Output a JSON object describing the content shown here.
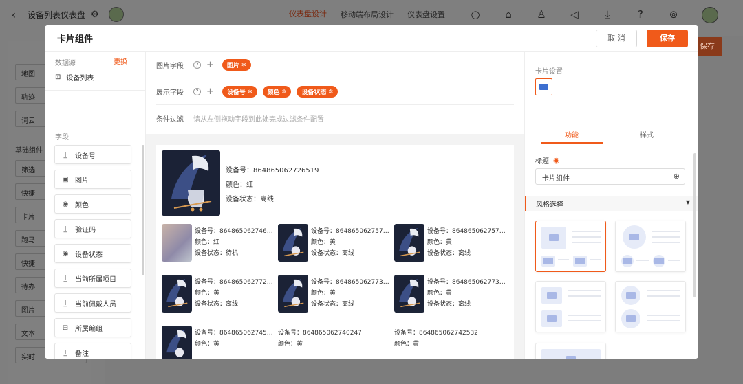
{
  "app": {
    "title": "设备列表仪表盘",
    "tabs": [
      {
        "label": "仪表盘设计",
        "active": true
      },
      {
        "label": "移动端布局设计",
        "active": false
      },
      {
        "label": "仪表盘设置",
        "active": false
      }
    ],
    "save_label": "保存",
    "sidebar_section": "基础组件",
    "sidebar_items": [
      "地图",
      "轨迹",
      "词云",
      "筛选",
      "快捷",
      "卡片",
      "跑马",
      "快捷",
      "待办",
      "图片",
      "文本",
      "实时"
    ]
  },
  "modal": {
    "title": "卡片组件",
    "cancel_label": "取 消",
    "save_label": "保存",
    "left": {
      "datasource_label": "数据源",
      "change_label": "更换",
      "datasource_name": "设备列表",
      "fields_label": "字段",
      "fields": [
        {
          "label": "设备号",
          "icon": "text-field-icon",
          "glyph": "I̲"
        },
        {
          "label": "图片",
          "icon": "image-field-icon",
          "glyph": "▣"
        },
        {
          "label": "颜色",
          "icon": "radio-field-icon",
          "glyph": "◉"
        },
        {
          "label": "验证码",
          "icon": "text-field-icon",
          "glyph": "I̲"
        },
        {
          "label": "设备状态",
          "icon": "radio-field-icon",
          "glyph": "◉"
        },
        {
          "label": "当前所属项目",
          "icon": "text-field-icon",
          "glyph": "I̲"
        },
        {
          "label": "当前佩戴人员",
          "icon": "text-field-icon",
          "glyph": "I̲"
        },
        {
          "label": "所属编组",
          "icon": "group-field-icon",
          "glyph": "⊟"
        },
        {
          "label": "备注",
          "icon": "text-field-icon",
          "glyph": "I̲"
        }
      ]
    },
    "center": {
      "image_field_label": "图片字段",
      "image_tags": [
        "图片"
      ],
      "display_field_label": "展示字段",
      "display_tags": [
        "设备号",
        "颜色",
        "设备状态"
      ],
      "filter_label": "条件过滤",
      "filter_hint": "请从左侧拖动字段到此处完成过滤条件配置",
      "featured": {
        "device_no": "设备号：864865062726519",
        "color": "颜色：红",
        "status": "设备状态：离线"
      },
      "cards": [
        {
          "device_no": "设备号：8648650627465...",
          "color": "颜色：红",
          "status": "设备状态：待机",
          "thumb": "photo"
        },
        {
          "device_no": "设备号：8648650627579...",
          "color": "颜色：黄",
          "status": "设备状态：离线",
          "thumb": "device"
        },
        {
          "device_no": "设备号：8648650627577...",
          "color": "颜色：黄",
          "status": "设备状态：离线",
          "thumb": "device"
        },
        {
          "device_no": "设备号：8648650627729...",
          "color": "颜色：黄",
          "status": "设备状态：离线",
          "thumb": "device"
        },
        {
          "device_no": "设备号：8648650627736...",
          "color": "颜色：黄",
          "status": "设备状态：离线",
          "thumb": "device"
        },
        {
          "device_no": "设备号：8648650627737...",
          "color": "颜色：黄",
          "status": "设备状态：离线",
          "thumb": "device"
        },
        {
          "device_no": "设备号：8648650627457...",
          "color": "颜色：黄",
          "status": "",
          "thumb": "device"
        },
        {
          "device_no": "设备号：864865062740247",
          "color": "颜色：黄",
          "status": "",
          "thumb": "none"
        },
        {
          "device_no": "设备号：864865062742532",
          "color": "颜色：黄",
          "status": "",
          "thumb": "none"
        }
      ]
    },
    "right": {
      "card_settings_label": "卡片设置",
      "tabs": [
        "功能",
        "样式"
      ],
      "active_tab": "功能",
      "title_label": "标题",
      "title_value": "卡片组件",
      "style_select_label": "风格选择",
      "accent_color": "#f05a1a",
      "swatch_color": "#3d6fd0"
    }
  }
}
